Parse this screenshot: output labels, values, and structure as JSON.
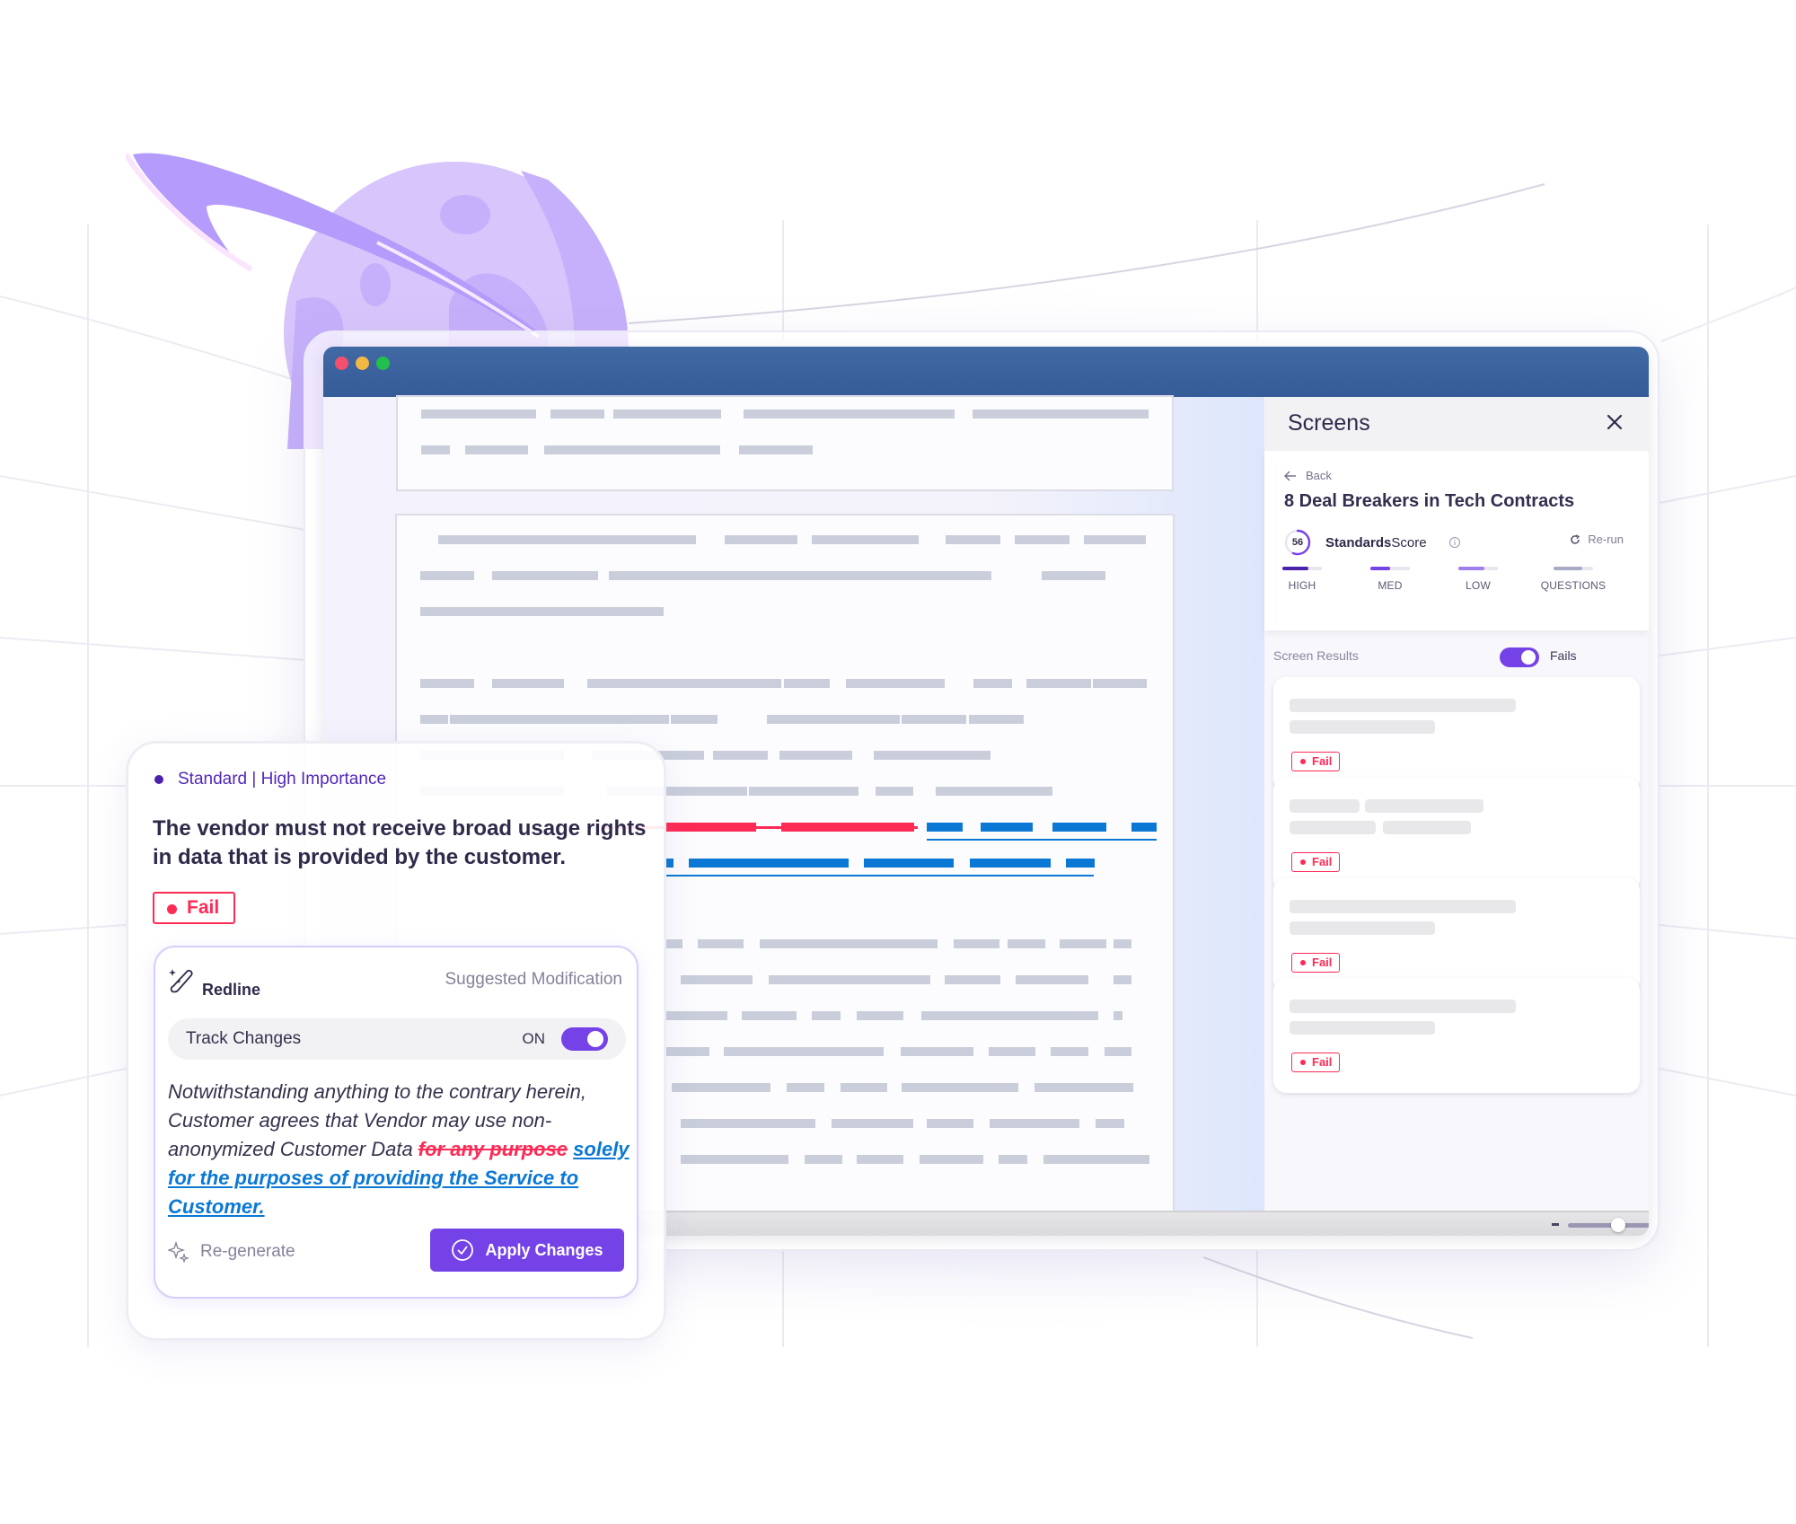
{
  "window": {
    "traffic_lights": [
      "close",
      "minimize",
      "maximize"
    ]
  },
  "panel": {
    "title": "Screens",
    "back_label": "Back",
    "screen_title": "8 Deal Breakers in Tech Contracts",
    "score": {
      "value": "56",
      "percent": 56,
      "label_bold": "Standards",
      "label_rest": "Score",
      "rerun_label": "Re-run"
    },
    "severity": [
      {
        "label": "HIGH",
        "fill": 0.65,
        "color": "#4c22ad"
      },
      {
        "label": "MED",
        "fill": 0.5,
        "color": "#7542e8"
      },
      {
        "label": "LOW",
        "fill": 0.65,
        "color": "#a07ef0"
      },
      {
        "label": "QUESTIONS",
        "fill": 0.72,
        "color": "#a9aac6"
      }
    ],
    "results_label": "Screen Results",
    "fails_toggle_label": "Fails",
    "fails_toggle_on": true,
    "results": [
      {
        "status": "Fail"
      },
      {
        "status": "Fail"
      },
      {
        "status": "Fail"
      },
      {
        "status": "Fail"
      }
    ]
  },
  "card": {
    "importance": "Standard | High Importance",
    "rule": "The vendor must not receive broad usage rights in data that is provided by the customer.",
    "status": "Fail",
    "redline": {
      "title": "Redline",
      "subtitle": "Suggested Modification",
      "track_changes_label": "Track Changes",
      "track_changes_state": "ON",
      "clause_plain": "Notwithstanding anything to the contrary herein, Customer agrees that Vendor may use non-anonymized Customer Data ",
      "clause_deleted": "for any purpose",
      "clause_inserted": "solely for the purposes of providing the Service to Customer.",
      "regenerate_label": "Re-generate",
      "apply_label": "Apply Changes"
    }
  },
  "colors": {
    "accent": "#7542e8",
    "fail": "#ff2a55",
    "insert": "#0a78d4",
    "titlebar": "#3b64a0"
  }
}
